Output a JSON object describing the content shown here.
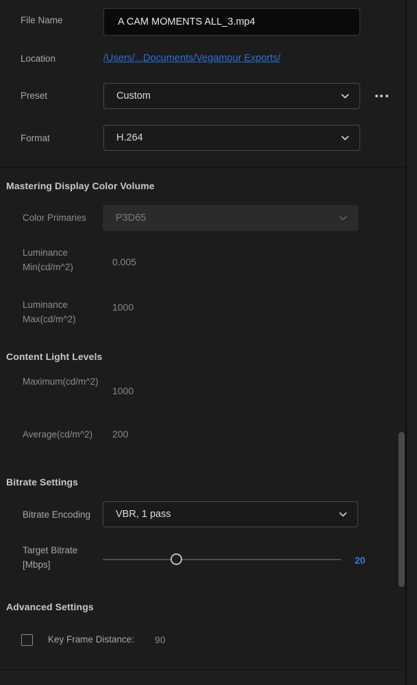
{
  "export_settings": {
    "file_name": {
      "label": "File Name",
      "value": "A CAM MOMENTS ALL_3.mp4"
    },
    "location": {
      "label": "Location",
      "value": "/Users/...Documents/Vegamour Exports/"
    },
    "preset": {
      "label": "Preset",
      "value": "Custom",
      "more_icon": "more-horizontal-icon"
    },
    "format": {
      "label": "Format",
      "value": "H.264"
    }
  },
  "mastering_display_color_volume": {
    "heading": "Mastering Display Color Volume",
    "color_primaries": {
      "label": "Color Primaries",
      "value": "P3D65",
      "disabled": true
    },
    "luminance_min": {
      "label": "Luminance Min(cd/m^2)",
      "value": "0.005"
    },
    "luminance_max": {
      "label": "Luminance Max(cd/m^2)",
      "value": "1000"
    }
  },
  "content_light_levels": {
    "heading": "Content Light Levels",
    "maximum": {
      "label": "Maximum(cd/m^2)",
      "value": "1000"
    },
    "average": {
      "label": "Average(cd/m^2)",
      "value": "200"
    }
  },
  "bitrate_settings": {
    "heading": "Bitrate Settings",
    "bitrate_encoding": {
      "label": "Bitrate Encoding",
      "value": "VBR, 1 pass"
    },
    "target_bitrate": {
      "label": "Target Bitrate [Mbps]",
      "value": "20",
      "slider_percent": 31
    }
  },
  "advanced_settings": {
    "heading": "Advanced Settings",
    "key_frame_distance": {
      "label": "Key Frame Distance:",
      "value": "90",
      "checked": false
    }
  },
  "colors": {
    "accent_link": "#2f6fd0",
    "accent_value": "#2f7de0",
    "panel_bg": "#1c1c1c",
    "input_bg": "#0a0a0a",
    "disabled_field_bg": "#2b2b2b"
  }
}
